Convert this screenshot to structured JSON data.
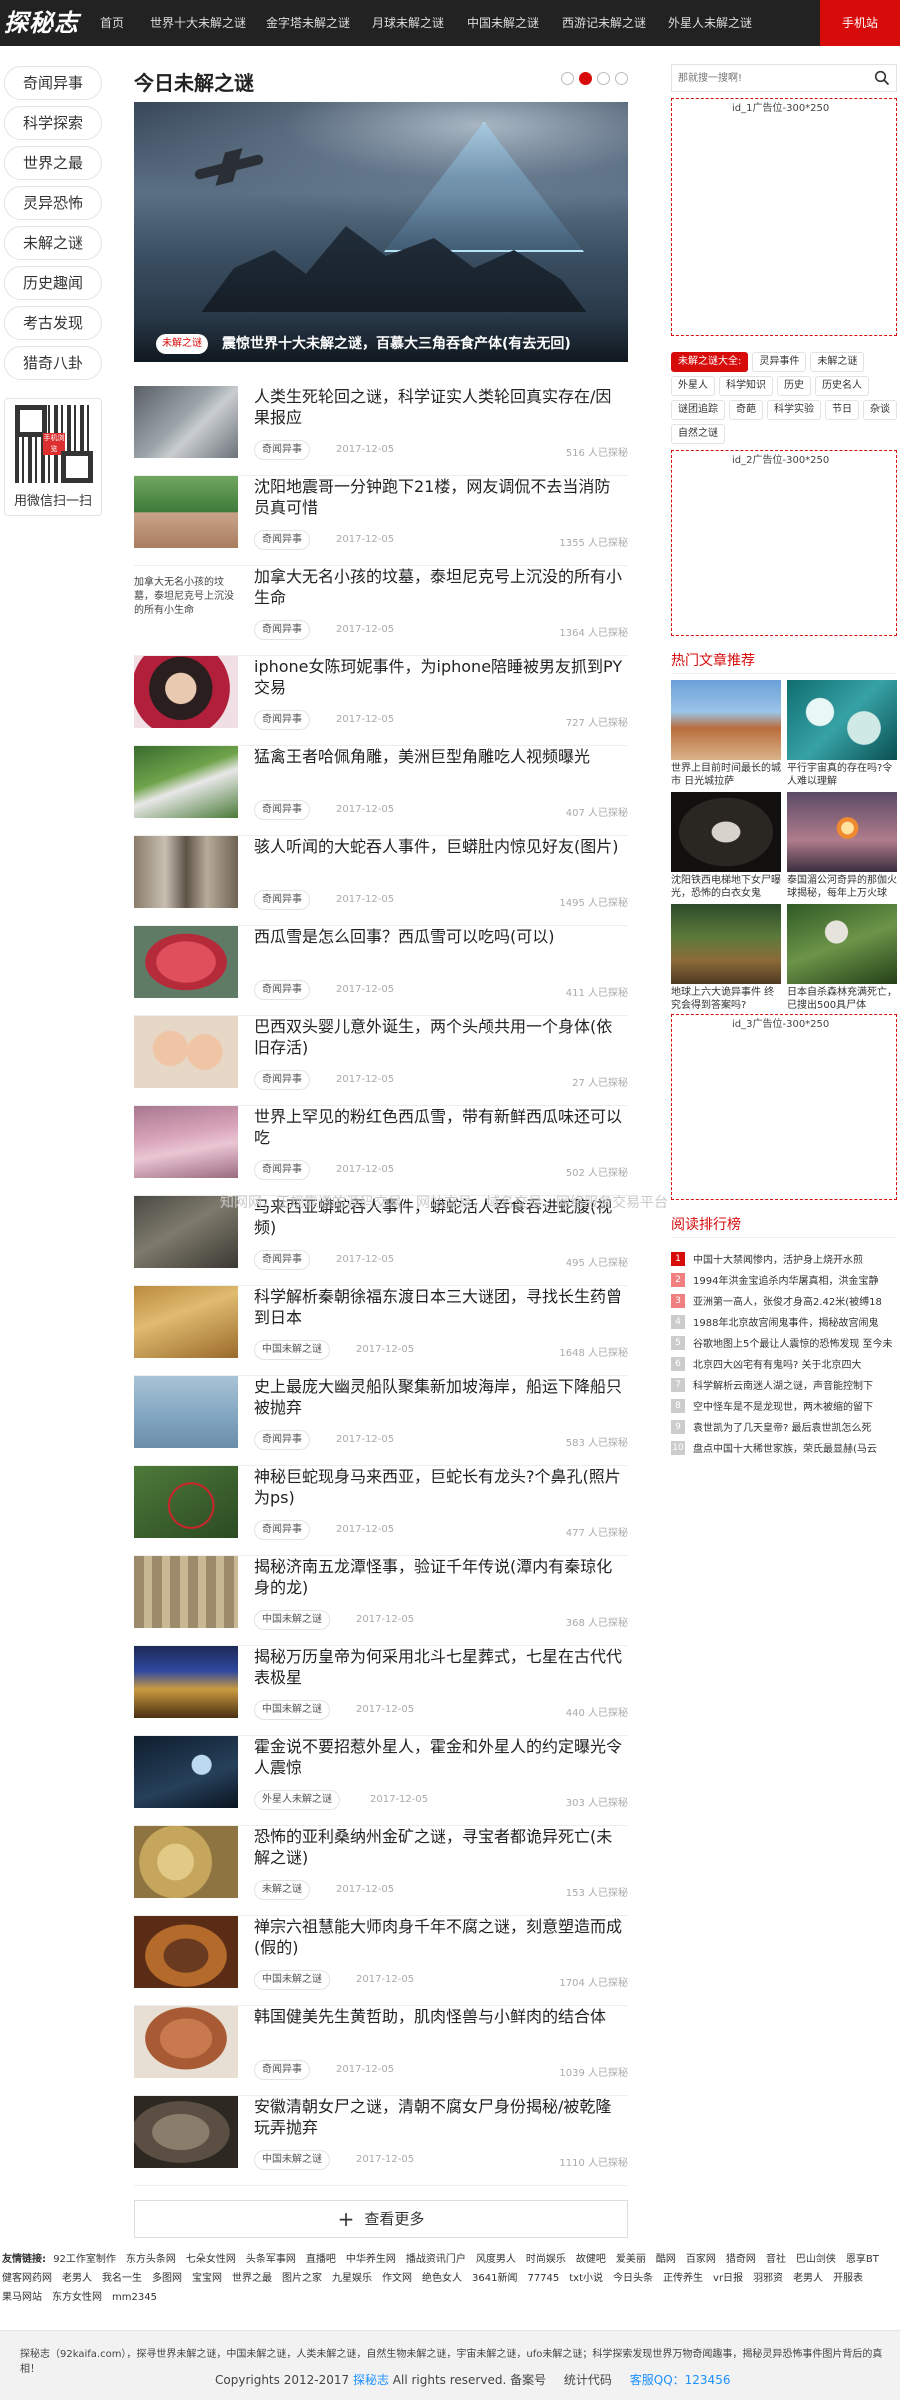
{
  "site": {
    "logo": "探秘志"
  },
  "nav": {
    "items": [
      "首页",
      "世界十大未解之谜",
      "金字塔未解之谜",
      "月球未解之谜",
      "中国未解之谜",
      "西游记未解之谜",
      "外星人未解之谜"
    ],
    "mobile": "手机站"
  },
  "categories": [
    "奇闻异事",
    "科学探索",
    "世界之最",
    "灵异恐怖",
    "未解之谜",
    "历史趣闻",
    "考古发现",
    "猎奇八卦"
  ],
  "qr": {
    "mark": "手机浏览",
    "caption": "用微信扫一扫"
  },
  "main": {
    "title": "今日未解之谜",
    "hero": {
      "tag": "未解之谜",
      "caption": "震惊世界十大未解之谜，百慕大三角吞食产体(有去无回)"
    },
    "thumb_text": "加拿大无名小孩的坟墓，泰坦尼克号上沉没的所有小生命",
    "items": [
      {
        "title": "人类生死轮回之谜，科学证实人类轮回真实存在/因果报应",
        "tag": "奇闻异事",
        "date": "2017-12-05",
        "views": "516 人已探秘"
      },
      {
        "title": "沈阳地震哥一分钟跑下21楼，网友调侃不去当消防员真可惜",
        "tag": "奇闻异事",
        "date": "2017-12-05",
        "views": "1355 人已探秘"
      },
      {
        "title": "加拿大无名小孩的坟墓，泰坦尼克号上沉没的所有小生命",
        "tag": "奇闻异事",
        "date": "2017-12-05",
        "views": "1364 人已探秘"
      },
      {
        "title": "iphone女陈珂妮事件，为iphone陪睡被男友抓到PY交易",
        "tag": "奇闻异事",
        "date": "2017-12-05",
        "views": "727 人已探秘"
      },
      {
        "title": "猛禽王者哈佩角雕，美洲巨型角雕吃人视频曝光",
        "tag": "奇闻异事",
        "date": "2017-12-05",
        "views": "407 人已探秘"
      },
      {
        "title": "骇人听闻的大蛇吞人事件，巨蟒肚内惊见好友(图片)",
        "tag": "奇闻异事",
        "date": "2017-12-05",
        "views": "1495 人已探秘"
      },
      {
        "title": "西瓜雪是怎么回事？西瓜雪可以吃吗(可以)",
        "tag": "奇闻异事",
        "date": "2017-12-05",
        "views": "411 人已探秘"
      },
      {
        "title": "巴西双头婴儿意外诞生，两个头颅共用一个身体(依旧存活)",
        "tag": "奇闻异事",
        "date": "2017-12-05",
        "views": "27 人已探秘"
      },
      {
        "title": "世界上罕见的粉红色西瓜雪，带有新鲜西瓜味还可以吃",
        "tag": "奇闻异事",
        "date": "2017-12-05",
        "views": "502 人已探秘"
      },
      {
        "title": "马来西亚蟒蛇吞人事件，蟒蛇活人吞食吞进蛇腹(视频)",
        "tag": "奇闻异事",
        "date": "2017-12-05",
        "views": "495 人已探秘"
      },
      {
        "title": "科学解析秦朝徐福东渡日本三大谜团，寻找长生药曾到日本",
        "tag": "中国未解之谜",
        "date": "2017-12-05",
        "views": "1648 人已探秘"
      },
      {
        "title": "史上最庞大幽灵船队聚集新加坡海岸，船运下降船只被抛弃",
        "tag": "奇闻异事",
        "date": "2017-12-05",
        "views": "583 人已探秘"
      },
      {
        "title": "神秘巨蛇现身马来西亚，巨蛇长有龙头?个鼻孔(照片为ps)",
        "tag": "奇闻异事",
        "date": "2017-12-05",
        "views": "477 人已探秘"
      },
      {
        "title": "揭秘济南五龙潭怪事，验证千年传说(潭内有秦琼化身的龙)",
        "tag": "中国未解之谜",
        "date": "2017-12-05",
        "views": "368 人已探秘"
      },
      {
        "title": "揭秘万历皇帝为何采用北斗七星葬式，七星在古代代表极星",
        "tag": "中国未解之谜",
        "date": "2017-12-05",
        "views": "440 人已探秘"
      },
      {
        "title": "霍金说不要招惹外星人，霍金和外星人的约定曝光令人震惊",
        "tag": "外星人未解之谜",
        "date": "2017-12-05",
        "views": "303 人已探秘"
      },
      {
        "title": "恐怖的亚利桑纳州金矿之谜，寻宝者都诡异死亡(未解之谜)",
        "tag": "未解之谜",
        "date": "2017-12-05",
        "views": "153 人已探秘"
      },
      {
        "title": "禅宗六祖慧能大师肉身千年不腐之谜，刻意塑造而成(假的)",
        "tag": "中国未解之谜",
        "date": "2017-12-05",
        "views": "1704 人已探秘"
      },
      {
        "title": "韩国健美先生黄哲助，肌肉怪兽与小鲜肉的结合体",
        "tag": "奇闻异事",
        "date": "2017-12-05",
        "views": "1039 人已探秘"
      },
      {
        "title": "安徽清朝女尸之谜，清朝不腐女尸身份揭秘/被乾隆玩弄抛弃",
        "tag": "中国未解之谜",
        "date": "2017-12-05",
        "views": "1110 人已探秘"
      }
    ],
    "more": "查看更多"
  },
  "right": {
    "search_placeholder": "那就搜一搜啊!",
    "ad1": "id_1广告位-300*250",
    "ad2": "id_2广告位-300*250",
    "ad3": "id_3广告位-300*250",
    "tags": [
      "未解之谜大全:",
      "灵异事件",
      "未解之谜",
      "外星人",
      "科学知识",
      "历史",
      "历史名人",
      "谜团追踪",
      "奇葩",
      "科学实验",
      "节日",
      "杂谈",
      "自然之谜"
    ],
    "rec_title": "热门文章推荐",
    "recs": [
      "世界上目前时间最长的城市 日光城拉萨",
      "平行宇宙真的存在吗?令人难以理解",
      "沈阳铁西电梯地下女尸曝光，恐怖的白衣女鬼",
      "泰国湄公河奇异的那伽火球揭秘，每年上万火球",
      "地球上六大诡异事件 终究会得到答案吗?",
      "日本自杀森林充满死亡，已搜出500具尸体"
    ],
    "rank_title": "阅读排行榜",
    "rank": [
      "中国十大禁闻惨内，活护身上烧开水煎",
      "1994年洪金宝追杀内华屠真相，洪金宝静",
      "亚洲第一高人，张俊才身高2.42米(被缚18",
      "1988年北京故宫闹鬼事件，揭秘故宫闹鬼",
      "谷歌地图上5个最让人震惊的恐怖发现 至今未",
      "北京四大凶宅有有鬼吗? 关于北京四大",
      "科学解析云南迷人湖之谜，声音能控制下",
      "空中怪车是不是龙现世，两木被缩的留下",
      "袁世凯为了几天皇帝? 最后袁世凯怎么死",
      "盘点中国十大稀世家族，荣氏最显赫(马云"
    ]
  },
  "watermark": "知网网，正规靠谱的源码交易，网站交易，域名交易，网络服务交易平台",
  "friends": {
    "label": "友情链接:",
    "links": [
      "92工作室制作",
      "东方头条网",
      "七朵女性网",
      "头条军事网",
      "直播吧",
      "中华养生网",
      "播战资讯门户",
      "风度男人",
      "时尚娱乐",
      "故健吧",
      "爱美丽",
      "酷网",
      "百家网",
      "猎奇网",
      "音社",
      "巴山剑侠",
      "恩享BT",
      "健客网药网",
      "老男人",
      "我名一生",
      "多图网",
      "宝宝网",
      "世界之最",
      "图片之家",
      "九星娱乐",
      "作文网",
      "绝色女人",
      "3641新闻",
      "77745",
      "txt小说",
      "今日头条",
      "正传养生",
      "vr日报",
      "羽邪资",
      "老男人",
      "开服表",
      "果马网站",
      "东方女性网",
      "mm2345"
    ]
  },
  "footer": {
    "line1": "探秘志（92kaifa.com），探寻世界未解之谜，中国未解之谜，人类未解之谜，自然生物未解之谜，宇宙未解之谜，ufo未解之谜；科学探索发现世界万物奇闻趣事，揭秘灵异恐怖事件图片背后的真相！",
    "copyright": "Copyrights 2012-2017",
    "site_link": "探秘志",
    "rights": "All rights reserved. 备案号",
    "stats": "统计代码",
    "qq": "客服QQ：123456"
  }
}
